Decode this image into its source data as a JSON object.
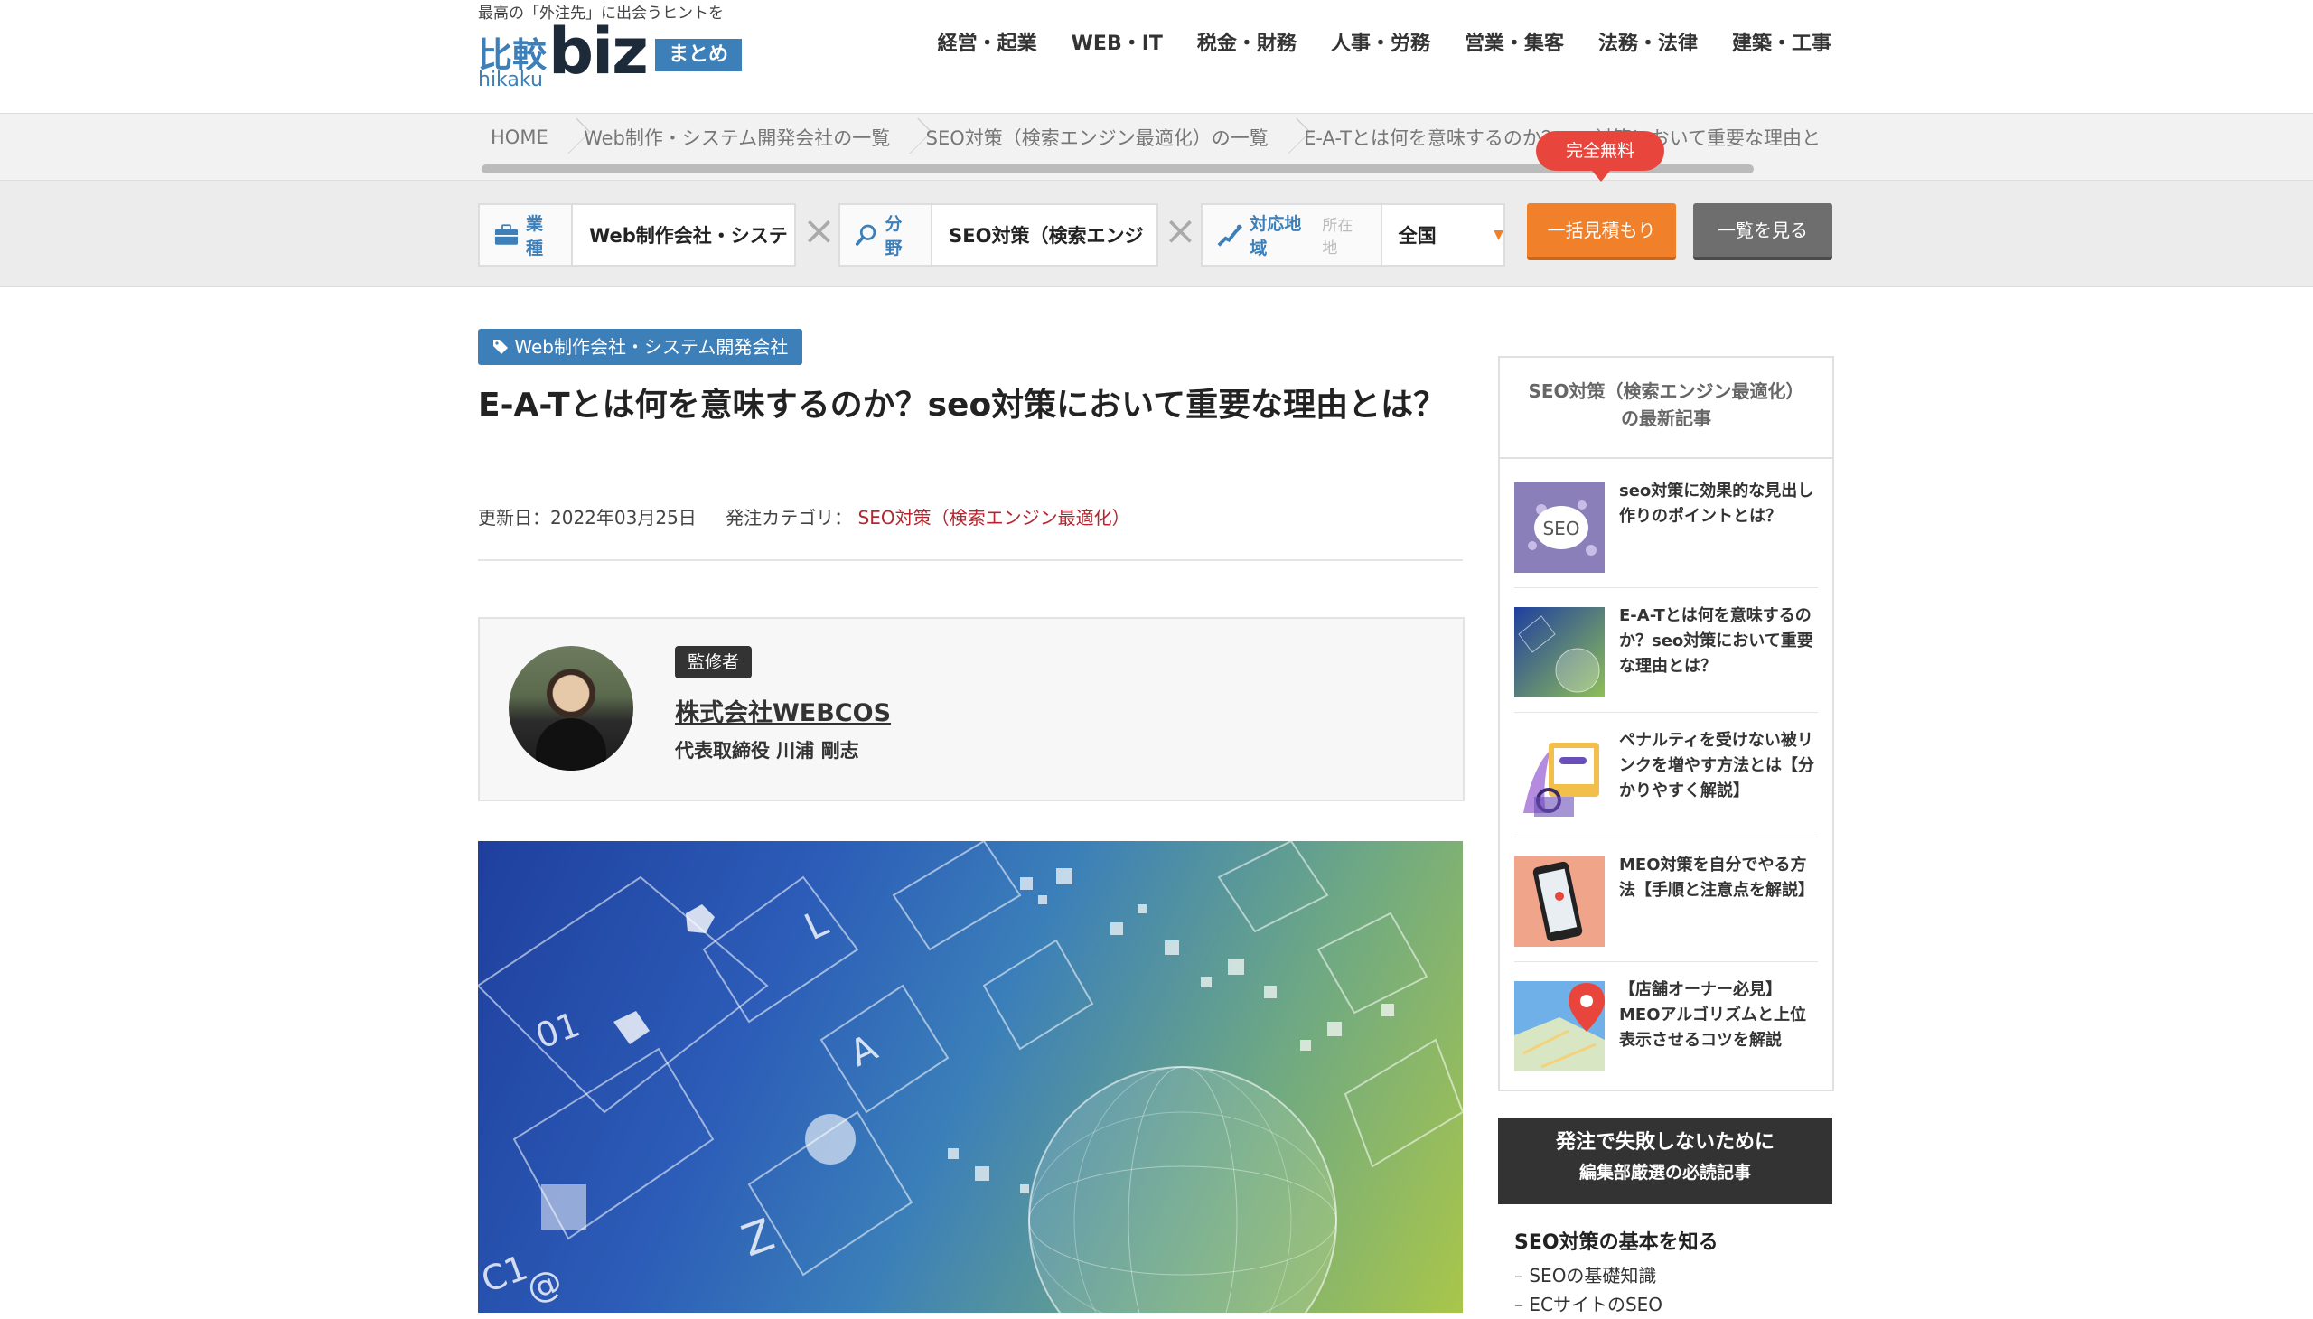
{
  "header": {
    "tagline": "最高の「外注先」に出会うヒントを",
    "logo": {
      "kanji": "比較",
      "roman": "hikaku",
      "biz": "biz",
      "matome": "まとめ"
    },
    "nav": [
      "経営・起業",
      "WEB・IT",
      "税金・財務",
      "人事・労務",
      "営業・集客",
      "法務・法律",
      "建築・工事"
    ]
  },
  "breadcrumb": [
    "HOME",
    "Web制作・システム開発会社の一覧",
    "SEO対策（検索エンジン最適化）の一覧",
    "E-A-Tとは何を意味するのか？seo対策において重要な理由と"
  ],
  "search": {
    "industry_label": "業種",
    "industry_value": "Web制作会社・システ",
    "field_label": "分野",
    "field_value": "SEO対策（検索エンジ",
    "area_label": "対応地域",
    "area_sub": "所在地",
    "area_value": "全国",
    "free_badge": "完全無料",
    "quote_button": "一括見積もり",
    "list_button": "一覧を見る",
    "accent_orange": "#f0802a"
  },
  "article": {
    "category_tag": "Web制作会社・システム開発会社",
    "title": "E-A-Tとは何を意味するのか？seo対策において重要な理由とは？",
    "updated_label": "更新日：2022年03月25日",
    "category_label": "発注カテゴリ：",
    "category_link": "SEO対策（検索エンジン最適化）"
  },
  "supervisor": {
    "badge": "監修者",
    "company": "株式会社WEBCOS",
    "role": "代表取締役 川浦 剛志"
  },
  "sidebar": {
    "latest_title_1": "SEO対策（検索エンジン最適化）",
    "latest_title_2": "の最新記事",
    "items": [
      {
        "title": "seo対策に効果的な見出し作りのポイントとは？",
        "thumb": "seo-bubble"
      },
      {
        "title": "E-A-Tとは何を意味するのか？seo対策において重要な理由とは？",
        "thumb": "digital-globe"
      },
      {
        "title": "ペナルティを受けない被リンクを増やす方法とは【分かりやすく解説】",
        "thumb": "devices-illustration"
      },
      {
        "title": "MEO対策を自分でやる方法【手順と注意点を解説】",
        "thumb": "smartphone-map"
      },
      {
        "title": "【店舗オーナー必見】MEOアルゴリズムと上位表示させるコツを解説",
        "thumb": "map-pin"
      }
    ],
    "promo_line1": "発注で失敗しないために",
    "promo_line2": "編集部厳選の必読記事",
    "seo_basics_title": "SEO対策の基本を知る",
    "seo_basics_items": [
      "SEOの基礎知識",
      "ECサイトのSEO"
    ]
  }
}
